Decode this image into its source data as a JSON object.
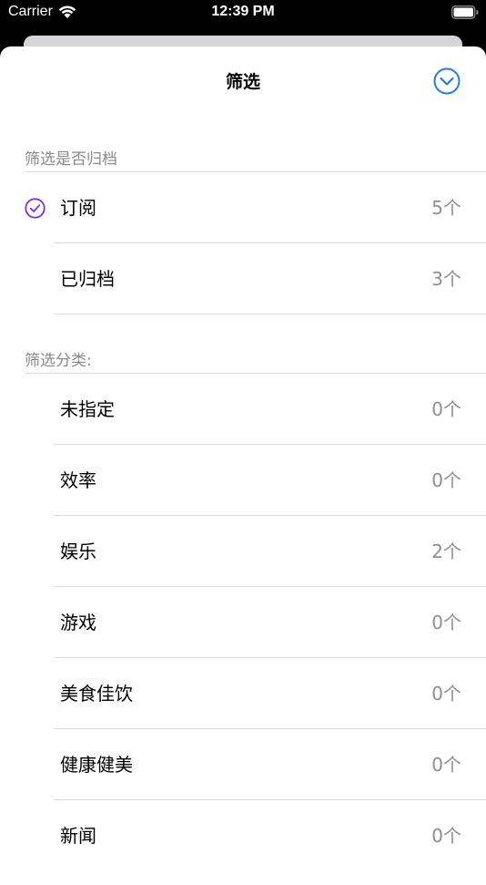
{
  "status_bar": {
    "carrier": "Carrier",
    "time": "12:39 PM"
  },
  "sheet": {
    "title": "筛选",
    "archive_section": {
      "header": "筛选是否归档",
      "rows": [
        {
          "label": "订阅",
          "count": "5个",
          "selected": true
        },
        {
          "label": "已归档",
          "count": "3个",
          "selected": false
        }
      ]
    },
    "category_section": {
      "header": "筛选分类:",
      "rows": [
        {
          "label": "未指定",
          "count": "0个"
        },
        {
          "label": "效率",
          "count": "0个"
        },
        {
          "label": "娱乐",
          "count": "2个"
        },
        {
          "label": "游戏",
          "count": "0个"
        },
        {
          "label": "美食佳饮",
          "count": "0个"
        },
        {
          "label": "健康健美",
          "count": "0个"
        },
        {
          "label": "新闻",
          "count": "0个"
        }
      ]
    }
  },
  "colors": {
    "accent_blue": "#1f7be3",
    "check_purple": "#7b2ee0",
    "secondary_text": "#8e8e93"
  },
  "icons": {
    "done": "chevron-down-circle-icon",
    "selected": "checkmark-circle-icon"
  }
}
